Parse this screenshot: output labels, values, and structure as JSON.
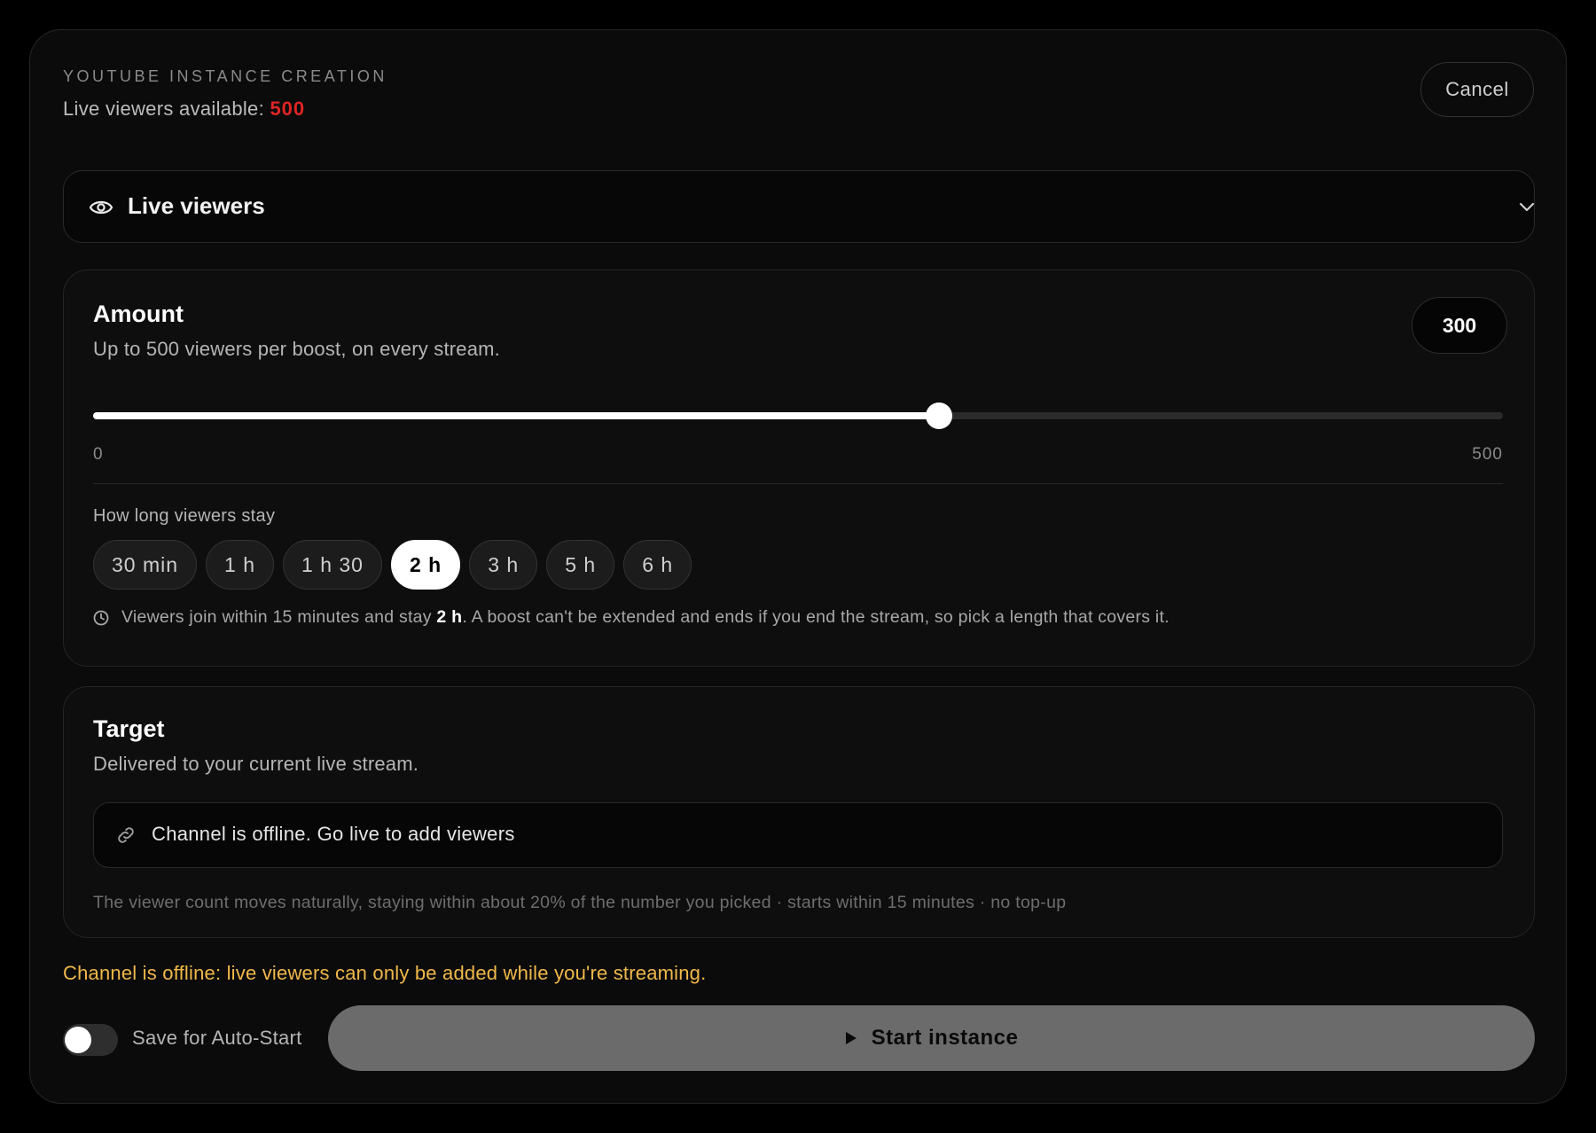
{
  "header": {
    "overline": "YOUTUBE INSTANCE CREATION",
    "available_label": "Live viewers available:",
    "available_value": "500",
    "cancel_label": "Cancel"
  },
  "service_select": {
    "icon": "eye-icon",
    "label": "Live viewers",
    "chevron_icon": "chevron-down-icon"
  },
  "amount": {
    "title": "Amount",
    "subtitle": "Up to 500 viewers per boost, on every stream.",
    "value": "300",
    "slider": {
      "min": 0,
      "max": 500,
      "value": 300,
      "min_label": "0",
      "max_label": "500"
    },
    "duration_label": "How long viewers stay",
    "durations": [
      "30 min",
      "1 h",
      "1 h 30",
      "2 h",
      "3 h",
      "5 h",
      "6 h"
    ],
    "selected_duration": "2 h",
    "info_icon": "clock-icon",
    "info_prefix": "Viewers join within 15 minutes and stay",
    "info_bold": "2 h",
    "info_suffix": ". A boost can't be extended and ends if you end the stream, so pick a length that covers it."
  },
  "target": {
    "title": "Target",
    "subtitle": "Delivered to your current live stream.",
    "link_icon": "link-icon",
    "offline_text": "Channel is offline. Go live to add viewers",
    "note": "The viewer count moves naturally, staying within about 20% of the number you picked · starts within 15 minutes · no top-up"
  },
  "footer": {
    "warning": "Channel is offline: live viewers can only be added while you're streaming.",
    "auto_start_label": "Save for Auto-Start",
    "auto_start_on": false,
    "start_label": "Start instance",
    "start_icon": "play-icon"
  },
  "colors": {
    "accent_red": "#e02424",
    "warning": "#f0b84a",
    "start_button": "#6b6b6b"
  }
}
